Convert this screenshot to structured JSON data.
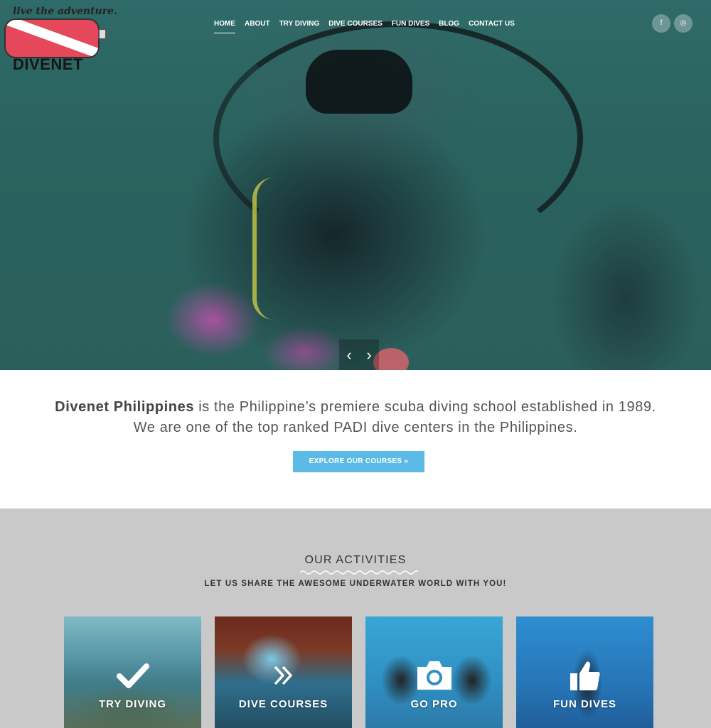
{
  "brand": {
    "tagline": "live the adventure.",
    "name": "DIVENET"
  },
  "nav": {
    "items": [
      {
        "label": "HOME",
        "active": true
      },
      {
        "label": "ABOUT",
        "active": false
      },
      {
        "label": "TRY DIVING",
        "active": false
      },
      {
        "label": "DIVE COURSES",
        "active": false
      },
      {
        "label": "FUN DIVES",
        "active": false
      },
      {
        "label": "BLOG",
        "active": false
      },
      {
        "label": "CONTACT US",
        "active": false
      }
    ]
  },
  "social": {
    "facebook_icon": "f",
    "instagram_icon": "◎"
  },
  "slider": {
    "prev": "‹",
    "next": "›"
  },
  "intro": {
    "highlight": "Divenet Philippines",
    "text": " is the Philippine’s premiere scuba diving school established in 1989. We are one of the top ranked PADI dive centers in the Philippines.",
    "button_label": "EXPLORE OUR COURSES  »"
  },
  "activities": {
    "title": "OUR ACTIVITIES",
    "subtitle": "LET US SHARE THE AWESOME UNDERWATER WORLD WITH YOU!",
    "cards": [
      {
        "label": "TRY DIVING",
        "icon": "check-icon"
      },
      {
        "label": "DIVE COURSES",
        "icon": "double-chevron-icon"
      },
      {
        "label": "GO PRO",
        "icon": "camera-icon"
      },
      {
        "label": "FUN DIVES",
        "icon": "thumbs-up-icon"
      }
    ]
  },
  "colors": {
    "accent": "#5bbbe6",
    "section_bg": "#c9c9c9",
    "logo_red": "#e5475b"
  }
}
